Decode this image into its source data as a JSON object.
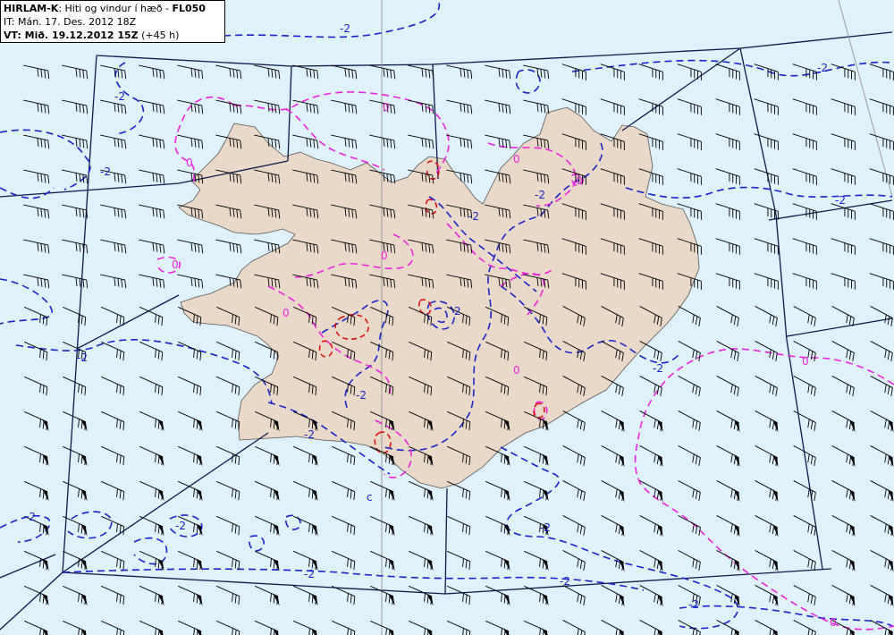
{
  "header": {
    "model": "HIRLAM-K",
    "description": ": Hiti og vindur í hæð - ",
    "level": "FL050",
    "it_prefix": "IT: ",
    "it_value": "Mán. 17. Des. 2012 18Z",
    "vt_prefix": "VT: ",
    "vt_value": "Mið. 19.12.2012 15Z",
    "vt_offset": " (+45 h)"
  },
  "contour_labels": {
    "minus_two": "-2",
    "zero": "0",
    "two": "2",
    "c": "c"
  },
  "colors": {
    "sea": "#dff1fb",
    "land": "#ead9c8",
    "minus2_contour": "#1a23c8",
    "zero_contour": "#ee22dd",
    "positive_contour": "#dd1111",
    "wind_barb": "#000000",
    "fir_boundary": "#0b1a4a"
  },
  "icons": [
    "wind-barb-icon",
    "pennant-50kt-icon"
  ]
}
